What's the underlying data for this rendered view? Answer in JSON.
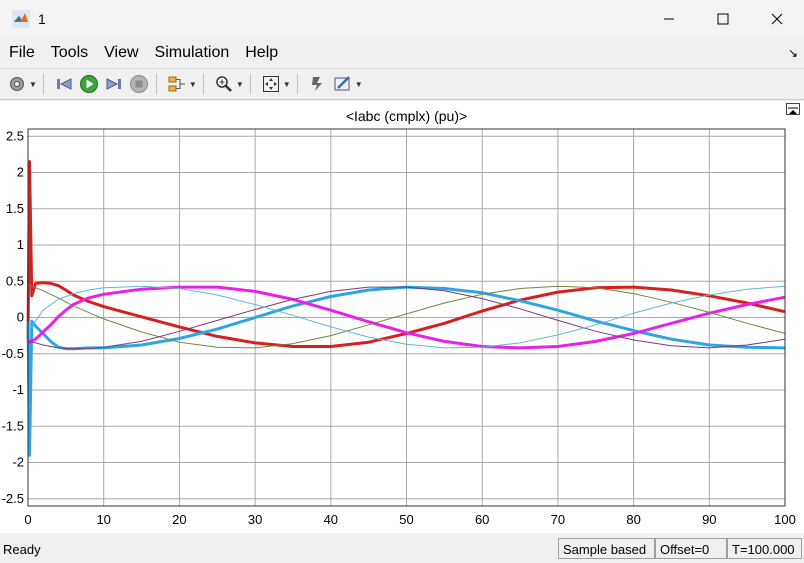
{
  "window": {
    "title": "1"
  },
  "menu": [
    "File",
    "Tools",
    "View",
    "Simulation",
    "Help"
  ],
  "toolbar": {
    "icons": [
      "gear-icon",
      "step-back-icon",
      "run-icon",
      "step-forward-icon",
      "stop-icon",
      "signal-select-icon",
      "zoom-icon",
      "autoscale-icon",
      "highlight-icon",
      "style-icon"
    ]
  },
  "chart_data": {
    "type": "line",
    "title": "<Iabc (cmplx) (pu)>",
    "xlim": [
      0,
      100
    ],
    "ylim": [
      -2.6,
      2.6
    ],
    "xticks": [
      0,
      10,
      20,
      30,
      40,
      50,
      60,
      70,
      80,
      90,
      100
    ],
    "yticks": [
      -2.5,
      -2,
      -1.5,
      -1,
      -0.5,
      0,
      0.5,
      1,
      1.5,
      2,
      2.5
    ],
    "grid": true,
    "series": [
      {
        "color": "#d62020",
        "width": 3.0,
        "x": [
          0,
          0.2,
          0.5,
          1,
          2,
          3,
          4,
          5,
          6,
          8,
          10,
          15,
          20,
          25,
          30,
          35,
          40,
          45,
          50,
          55,
          60,
          65,
          70,
          75,
          80,
          85,
          90,
          95,
          100
        ],
        "y": [
          -0.3,
          2.15,
          0.3,
          0.47,
          0.48,
          0.47,
          0.44,
          0.38,
          0.31,
          0.22,
          0.15,
          0.01,
          -0.13,
          -0.26,
          -0.35,
          -0.4,
          -0.4,
          -0.34,
          -0.22,
          -0.08,
          0.09,
          0.24,
          0.35,
          0.41,
          0.42,
          0.38,
          0.3,
          0.2,
          0.08
        ]
      },
      {
        "color": "#2ea3e6",
        "width": 3.0,
        "x": [
          0,
          0.2,
          0.5,
          1,
          2,
          3,
          4,
          5,
          6,
          8,
          10,
          15,
          20,
          25,
          30,
          35,
          40,
          45,
          50,
          55,
          60,
          65,
          70,
          75,
          80,
          85,
          90,
          95,
          100
        ],
        "y": [
          -0.05,
          -1.9,
          -0.05,
          -0.12,
          -0.22,
          -0.33,
          -0.41,
          -0.43,
          -0.43,
          -0.42,
          -0.42,
          -0.38,
          -0.29,
          -0.16,
          0.0,
          0.16,
          0.29,
          0.38,
          0.42,
          0.4,
          0.34,
          0.23,
          0.1,
          -0.05,
          -0.18,
          -0.3,
          -0.38,
          -0.41,
          -0.42
        ]
      },
      {
        "color": "#e622e6",
        "width": 3.0,
        "x": [
          0,
          1,
          2,
          3,
          4,
          5,
          6,
          8,
          10,
          15,
          20,
          25,
          30,
          35,
          40,
          45,
          50,
          55,
          60,
          65,
          70,
          75,
          80,
          85,
          90,
          95,
          100
        ],
        "y": [
          -0.35,
          -0.3,
          -0.2,
          -0.1,
          0.01,
          0.1,
          0.18,
          0.27,
          0.32,
          0.39,
          0.42,
          0.42,
          0.36,
          0.25,
          0.1,
          -0.06,
          -0.21,
          -0.33,
          -0.4,
          -0.42,
          -0.4,
          -0.33,
          -0.22,
          -0.08,
          0.06,
          0.18,
          0.28
        ]
      },
      {
        "color": "#6f8a3a",
        "width": 1.0,
        "x": [
          0,
          2,
          4,
          6,
          8,
          10,
          15,
          20,
          25,
          30,
          35,
          40,
          45,
          50,
          55,
          60,
          65,
          70,
          75,
          80,
          85,
          90,
          95,
          100
        ],
        "y": [
          0.45,
          0.37,
          0.27,
          0.16,
          0.07,
          -0.02,
          -0.2,
          -0.34,
          -0.41,
          -0.42,
          -0.36,
          -0.25,
          -0.1,
          0.05,
          0.2,
          0.32,
          0.4,
          0.43,
          0.41,
          0.33,
          0.21,
          0.07,
          -0.08,
          -0.22
        ]
      },
      {
        "color": "#7a3a7a",
        "width": 1.0,
        "x": [
          0,
          2,
          4,
          6,
          8,
          10,
          15,
          20,
          25,
          30,
          35,
          40,
          45,
          50,
          55,
          60,
          65,
          70,
          75,
          80,
          85,
          90,
          95,
          100
        ],
        "y": [
          -0.32,
          -0.38,
          -0.42,
          -0.43,
          -0.43,
          -0.41,
          -0.33,
          -0.19,
          -0.04,
          0.11,
          0.25,
          0.36,
          0.42,
          0.42,
          0.37,
          0.26,
          0.12,
          -0.04,
          -0.19,
          -0.31,
          -0.39,
          -0.42,
          -0.38,
          -0.3
        ]
      },
      {
        "color": "#5fb8d8",
        "width": 1.0,
        "x": [
          0,
          2,
          4,
          6,
          8,
          10,
          15,
          20,
          25,
          30,
          35,
          40,
          45,
          50,
          55,
          60,
          65,
          70,
          75,
          80,
          85,
          90,
          95,
          100
        ],
        "y": [
          -0.2,
          0.1,
          0.25,
          0.33,
          0.38,
          0.41,
          0.43,
          0.4,
          0.31,
          0.18,
          0.03,
          -0.13,
          -0.27,
          -0.37,
          -0.42,
          -0.41,
          -0.35,
          -0.24,
          -0.1,
          0.06,
          0.2,
          0.31,
          0.39,
          0.43
        ]
      }
    ]
  },
  "status": {
    "state": "Ready",
    "sample": "Sample based",
    "offset": "Offset=0",
    "time": "T=100.000"
  }
}
